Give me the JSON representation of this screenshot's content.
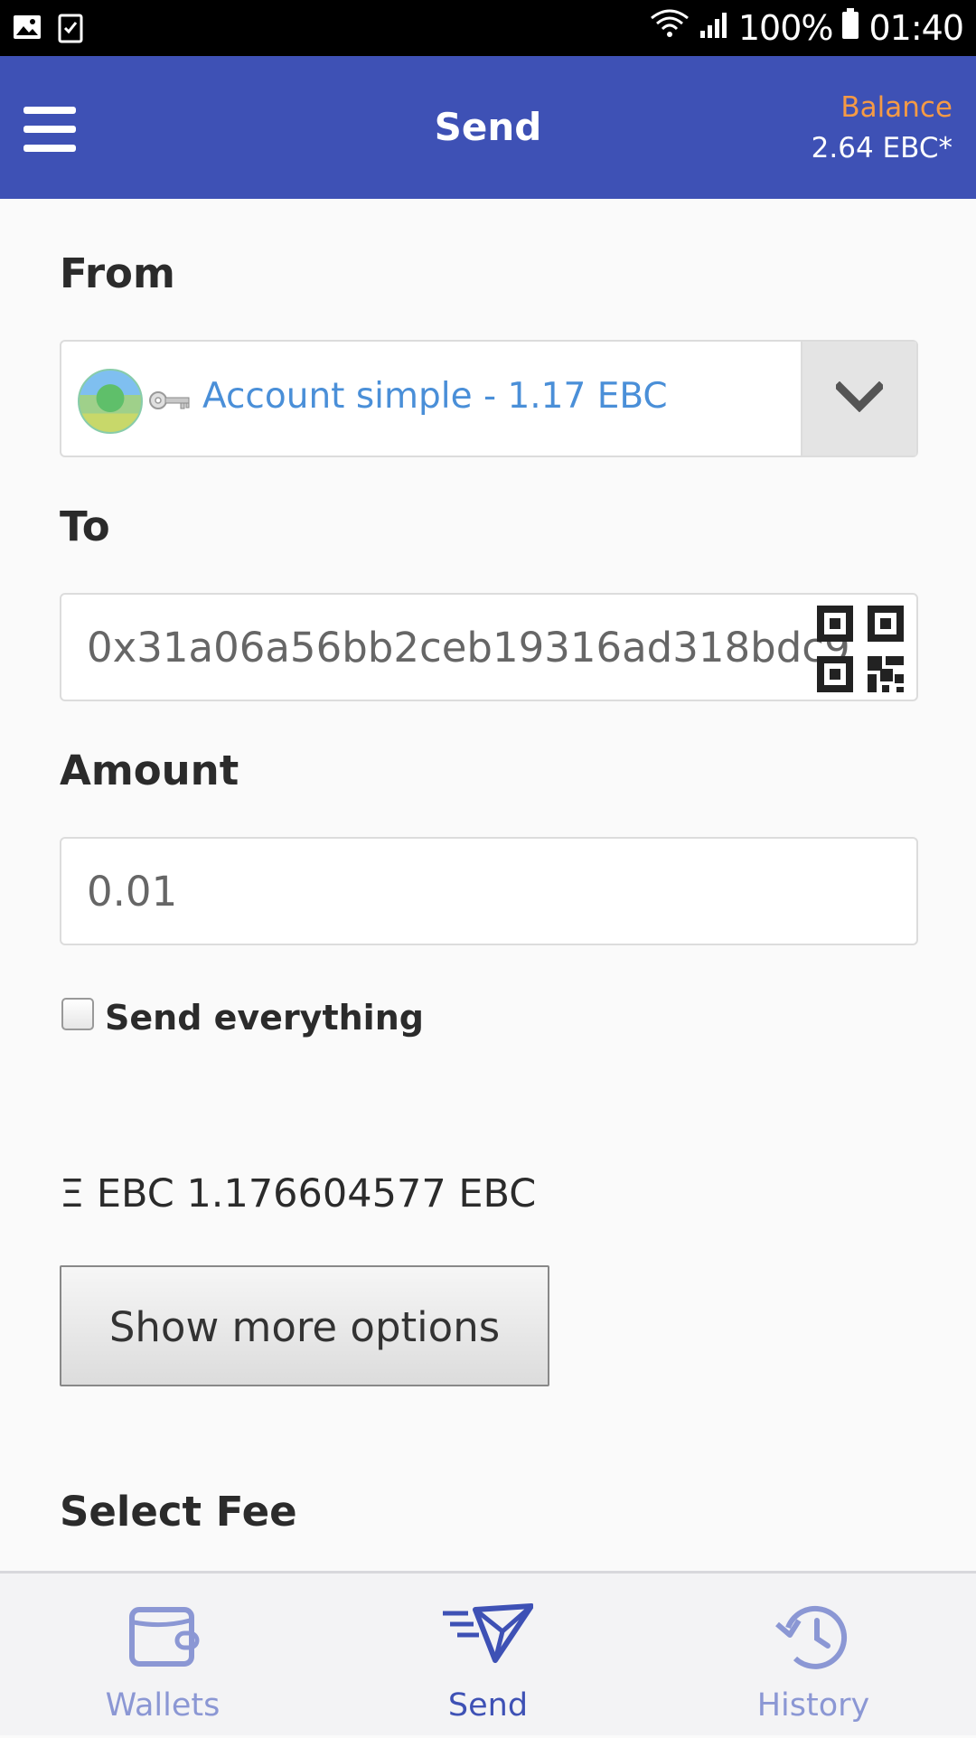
{
  "status_bar": {
    "battery": "100%",
    "time": "01:40",
    "left_icons": [
      "image-icon",
      "checklist-icon"
    ],
    "right_icons": [
      "wifi-icon",
      "signal-icon",
      "battery-icon"
    ]
  },
  "header": {
    "title": "Send",
    "balance_label": "Balance",
    "balance_value": "2.64 EBC*",
    "colors": {
      "bar": "#3e51b5",
      "balance_label": "#f59a45"
    }
  },
  "form": {
    "from_label": "From",
    "from_account": "Account simple - 1.17 EBC",
    "to_label": "To",
    "to_value": "0x31a06a56bb2ceb19316ad318bdc9",
    "amount_label": "Amount",
    "amount_value": "0.01",
    "send_everything_label": "Send everything",
    "send_everything_checked": false,
    "balance_line": "Ξ EBC 1.176604577 EBC",
    "more_options_label": "Show more options",
    "select_fee_label": "Select Fee"
  },
  "bottom_nav": {
    "items": [
      {
        "label": "Wallets",
        "icon": "wallet-icon",
        "active": false
      },
      {
        "label": "Send",
        "icon": "send-icon",
        "active": true
      },
      {
        "label": "History",
        "icon": "history-icon",
        "active": false
      }
    ],
    "colors": {
      "active": "#3e51b5",
      "inactive": "#8b97d4"
    }
  }
}
